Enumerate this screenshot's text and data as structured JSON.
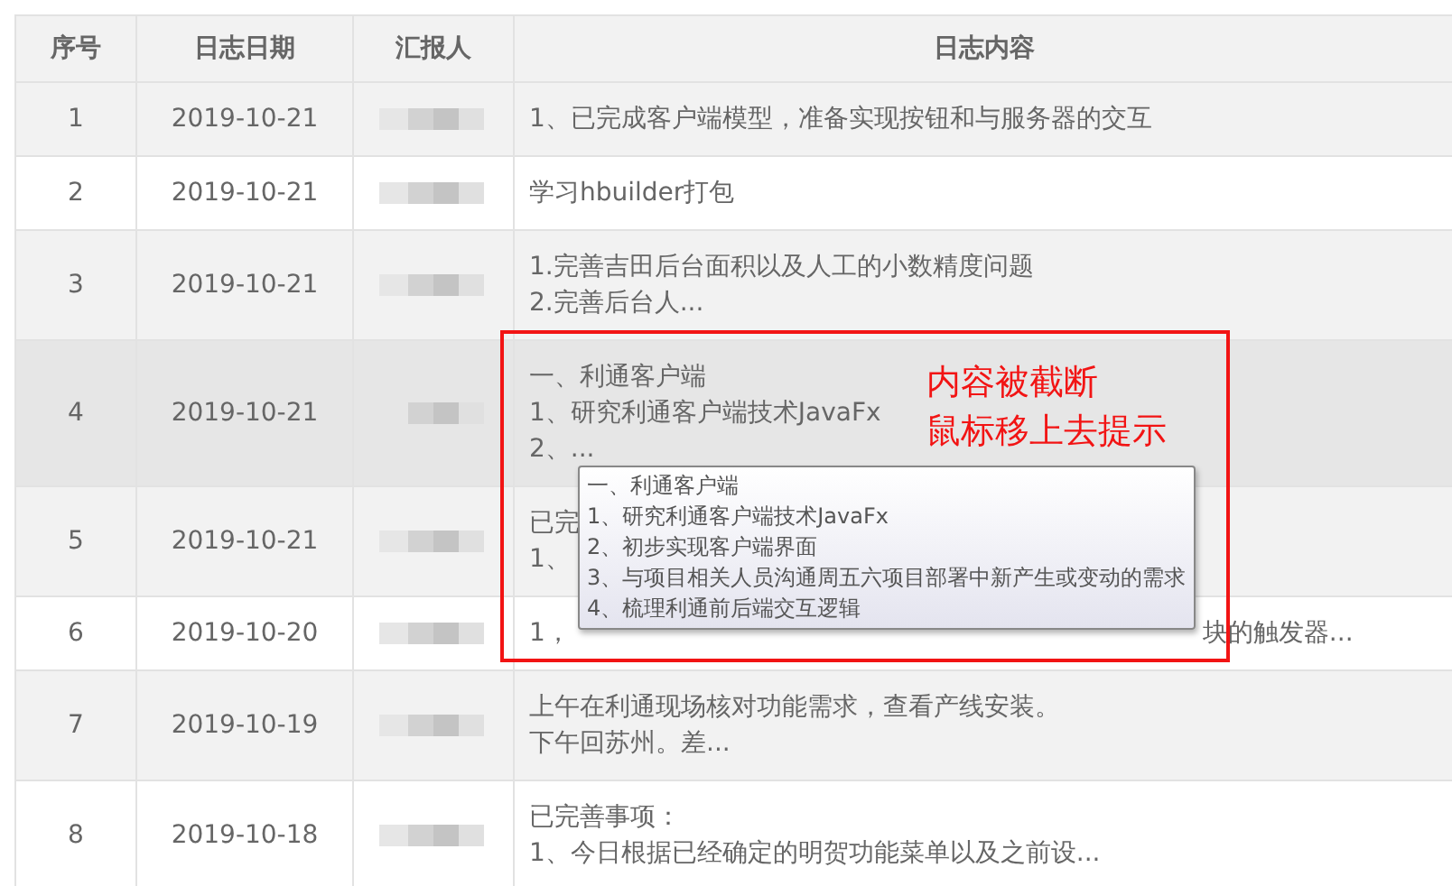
{
  "table": {
    "columns": [
      "序号",
      "日志日期",
      "汇报人",
      "日志内容"
    ],
    "rows": [
      {
        "no": "1",
        "date": "2019-10-21",
        "hovered": false,
        "content": [
          [
            "1、已完成客户端模型，准备实现按钮和与服务器的交互"
          ]
        ]
      },
      {
        "no": "2",
        "date": "2019-10-21",
        "hovered": false,
        "content": [
          [
            "学习hbuilder打包"
          ]
        ]
      },
      {
        "no": "3",
        "date": "2019-10-21",
        "hovered": false,
        "content": [
          [
            "1.完善吉田后台面积以及人工的小数精度问题"
          ],
          [
            "2.完善后台人..."
          ]
        ]
      },
      {
        "no": "4",
        "date": "2019-10-21",
        "hovered": true,
        "content": [
          [
            "一、利通客户端"
          ],
          [
            "1、研究利通客户端技术JavaFx"
          ],
          [
            "2、..."
          ]
        ]
      },
      {
        "no": "5",
        "date": "2019-10-21",
        "hovered": false,
        "content": [
          [
            "已完"
          ],
          [
            "1、"
          ]
        ]
      },
      {
        "no": "6",
        "date": "2019-10-20",
        "hovered": false,
        "content": [
          [
            "1，",
            "块的触发器..."
          ]
        ]
      },
      {
        "no": "7",
        "date": "2019-10-19",
        "hovered": false,
        "content": [
          [
            "上午在利通现场核对功能需求，查看产线安装。"
          ],
          [
            "下午回苏州。差..."
          ]
        ]
      },
      {
        "no": "8",
        "date": "2019-10-18",
        "hovered": false,
        "content": [
          [
            "已完善事项："
          ],
          [
            "1、今日根据已经确定的明贺功能菜单以及之前设..."
          ]
        ]
      }
    ]
  },
  "tooltip": {
    "lines": [
      "一、利通客户端",
      "1、研究利通客户端技术JavaFx",
      "2、初步实现客户端界面",
      "3、与项目相关人员沟通周五六项目部署中新产生或变动的需求",
      "4、梳理利通前后端交互逻辑"
    ]
  },
  "annotation": {
    "lines": [
      "内容被截断",
      "鼠标移上去提示"
    ]
  }
}
